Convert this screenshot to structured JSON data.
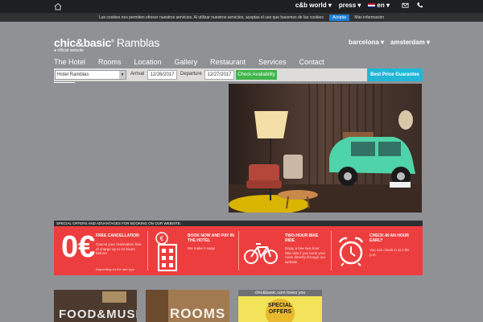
{
  "topbar": {
    "links": [
      {
        "label": "c&b world ▾"
      },
      {
        "label": "press ▾"
      },
      {
        "label": "en ▾"
      }
    ]
  },
  "cookie": {
    "message": "Las cookies nos permiten ofrecer nuestros servicios. Al utilizar nuestros servicios, aceptas el uso que hacemos de las cookies.",
    "accept_label": "Aceptar",
    "more_label": "Más información"
  },
  "brand": {
    "logo_main": "chic&basic",
    "logo_sub": "Ramblas",
    "tagline": "official website"
  },
  "cities": [
    {
      "label": "barcelona ▾"
    },
    {
      "label": "amsterdam ▾"
    }
  ],
  "nav": [
    {
      "label": "The Hotel"
    },
    {
      "label": "Rooms"
    },
    {
      "label": "Location"
    },
    {
      "label": "Gallery"
    },
    {
      "label": "Restaurant"
    },
    {
      "label": "Services"
    },
    {
      "label": "Contact"
    }
  ],
  "booking": {
    "hotel_value": "Hotel Ramblas",
    "arrival_label": "Arrival",
    "arrival_value": "12/26/2017",
    "departure_label": "Departure",
    "departure_value": "12/27/2017",
    "check_label": "Check Availability",
    "best_price_label": "Best Price Guarantee"
  },
  "offers": {
    "header": "SPECIAL OFFERS AND ADVANTAGES FOR BOOKING ON OUR WEBSITE:",
    "items": [
      {
        "title": "FREE CANCELLATION",
        "desc": "Cancel your reservation free of charge up to 24 hours before!",
        "note": "Depending on the rate type",
        "icon_text": "0€"
      },
      {
        "title": "BOOK NOW AND PAY IN THE HOTEL",
        "desc": "We make it easy!"
      },
      {
        "title": "TWO-HOUR BIKE RIDE",
        "desc": "Enjoy a free two-hour bike ride if you book your room directly through our website."
      },
      {
        "title": "CHECK-IN AN HOUR EARLY",
        "desc": "You can check in at 2:00 p.m."
      }
    ]
  },
  "tiles": [
    {
      "label": "FOOD&MUSIC"
    },
    {
      "label": "ROOMS"
    },
    {
      "header": "chic&basic.com loves you",
      "label": "SPECIAL OFFERS"
    }
  ],
  "colors": {
    "background": "#8f9195",
    "offers_red": "#ec3e3e",
    "accent_blue": "#22b7d6",
    "check_green": "#3fb54a"
  }
}
